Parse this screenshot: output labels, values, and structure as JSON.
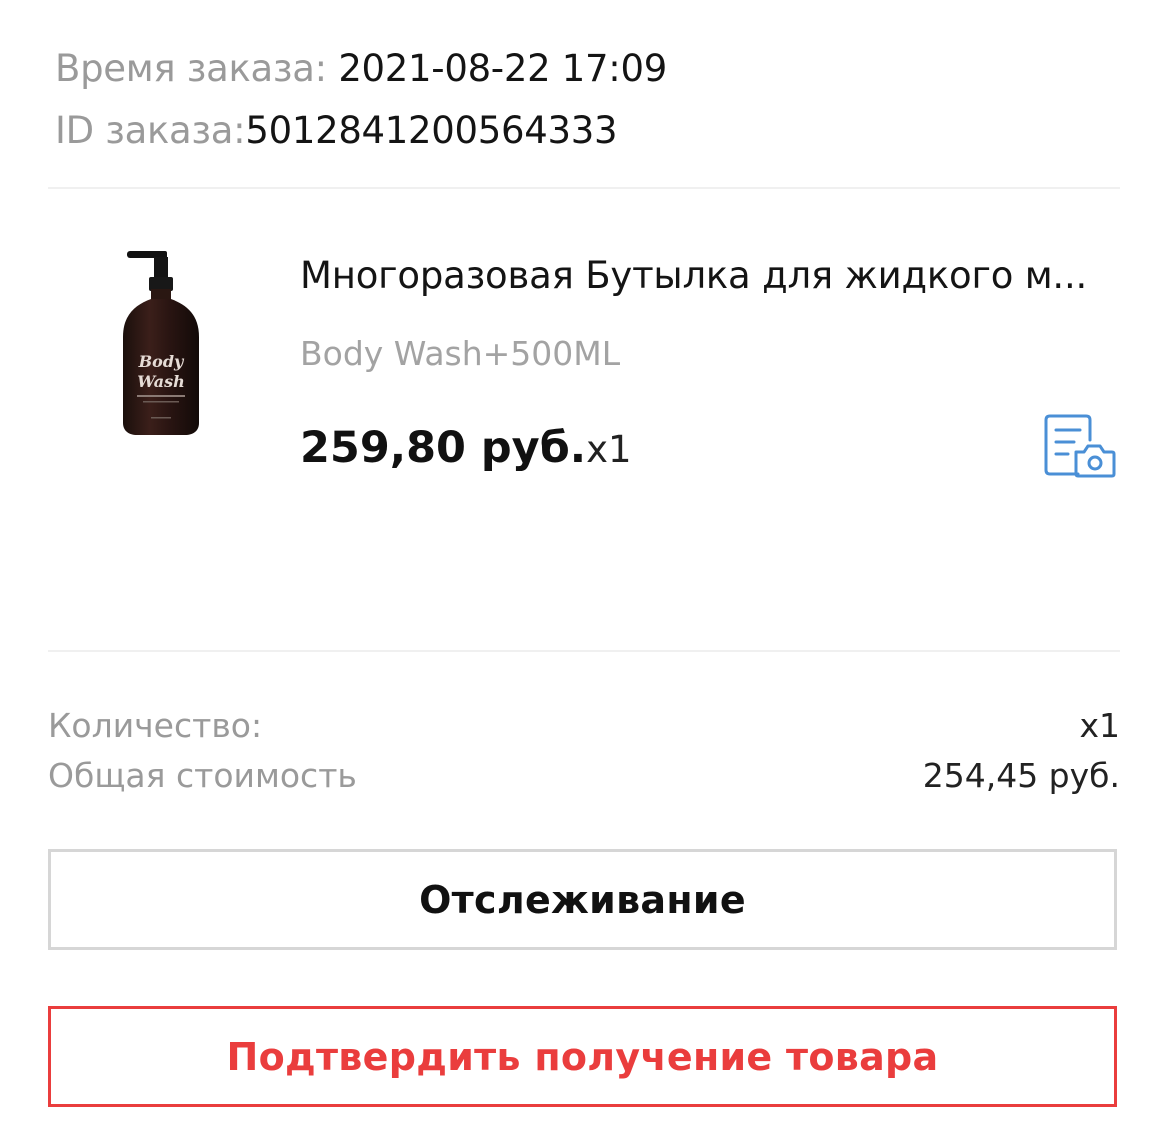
{
  "order": {
    "time_label": "Время заказа: ",
    "time_value": "2021-08-22 17:09",
    "id_label": "ID заказа:",
    "id_value": "5012841200564333"
  },
  "product": {
    "image_alt": "Body Wash",
    "image_text_line1": "Body",
    "image_text_line2": "Wash",
    "title": "Многоразовая Бутылка для жидкого м...",
    "variant": "Body Wash+500ML",
    "price": "259,80 руб.",
    "quantity": "x1",
    "photo_doc_icon": "document-camera-icon"
  },
  "summary": {
    "quantity_label": "Количество:",
    "quantity_value": "x1",
    "total_label": "Общая стоимость",
    "total_value": "254,45 руб."
  },
  "buttons": {
    "track_label": "Отслеживание",
    "confirm_label": "Подтвердить получение товара"
  },
  "colors": {
    "accent_red": "#ea3d3d",
    "icon_blue": "#4a8fd6",
    "label_gray": "#9a9a9a"
  }
}
